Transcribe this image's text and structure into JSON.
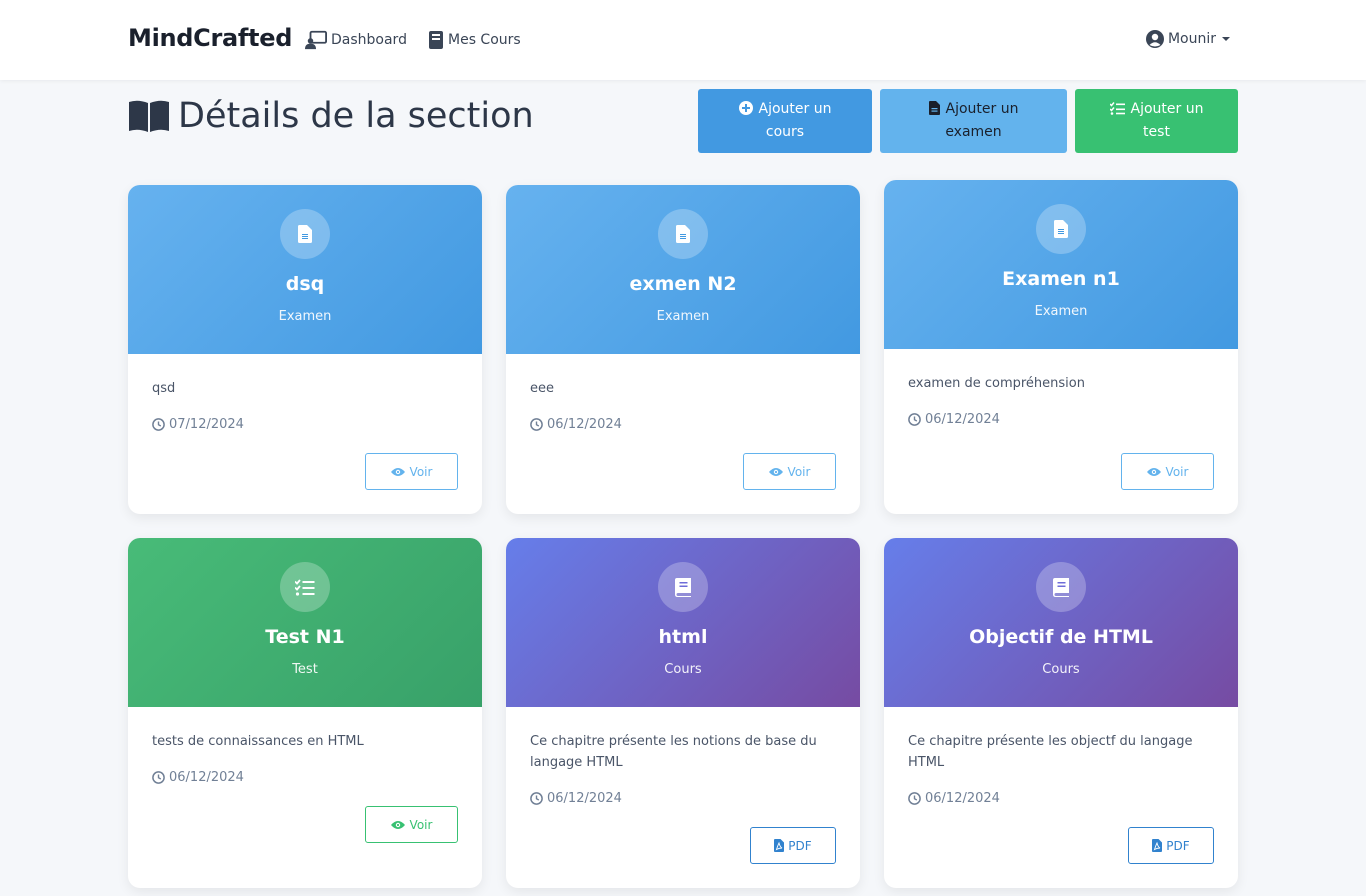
{
  "app": {
    "brand": "MindCrafted"
  },
  "nav": {
    "dashboard": "Dashboard",
    "courses": "Mes Cours",
    "user": "Mounir"
  },
  "page": {
    "title": "Détails de la section"
  },
  "actions": {
    "add_course": "Ajouter un cours",
    "add_exam": "Ajouter un examen",
    "add_test": "Ajouter un test"
  },
  "colors": {
    "exam": "#4299e1",
    "test": "#38c172",
    "course": "#764ba2"
  },
  "cards": [
    {
      "title": "dsq",
      "type": "Examen",
      "description": "qsd",
      "date": "07/12/2024",
      "action": "Voir",
      "icon": "file-icon"
    },
    {
      "title": "exmen N2",
      "type": "Examen",
      "description": "eee",
      "date": "06/12/2024",
      "action": "Voir",
      "icon": "file-icon"
    },
    {
      "title": "Examen n1",
      "type": "Examen",
      "description": "examen de compréhension",
      "date": "06/12/2024",
      "action": "Voir",
      "icon": "file-icon"
    },
    {
      "title": "Test N1",
      "type": "Test",
      "description": "tests de connaissances en HTML",
      "date": "06/12/2024",
      "action": "Voir",
      "icon": "list-check-icon"
    },
    {
      "title": "html",
      "type": "Cours",
      "description": "Ce chapitre présente les notions de base du langage HTML",
      "date": "06/12/2024",
      "action": "PDF",
      "icon": "book-icon"
    },
    {
      "title": "Objectif de HTML",
      "type": "Cours",
      "description": "Ce chapitre présente les objectf du langage HTML",
      "date": "06/12/2024",
      "action": "PDF",
      "icon": "book-icon"
    }
  ]
}
